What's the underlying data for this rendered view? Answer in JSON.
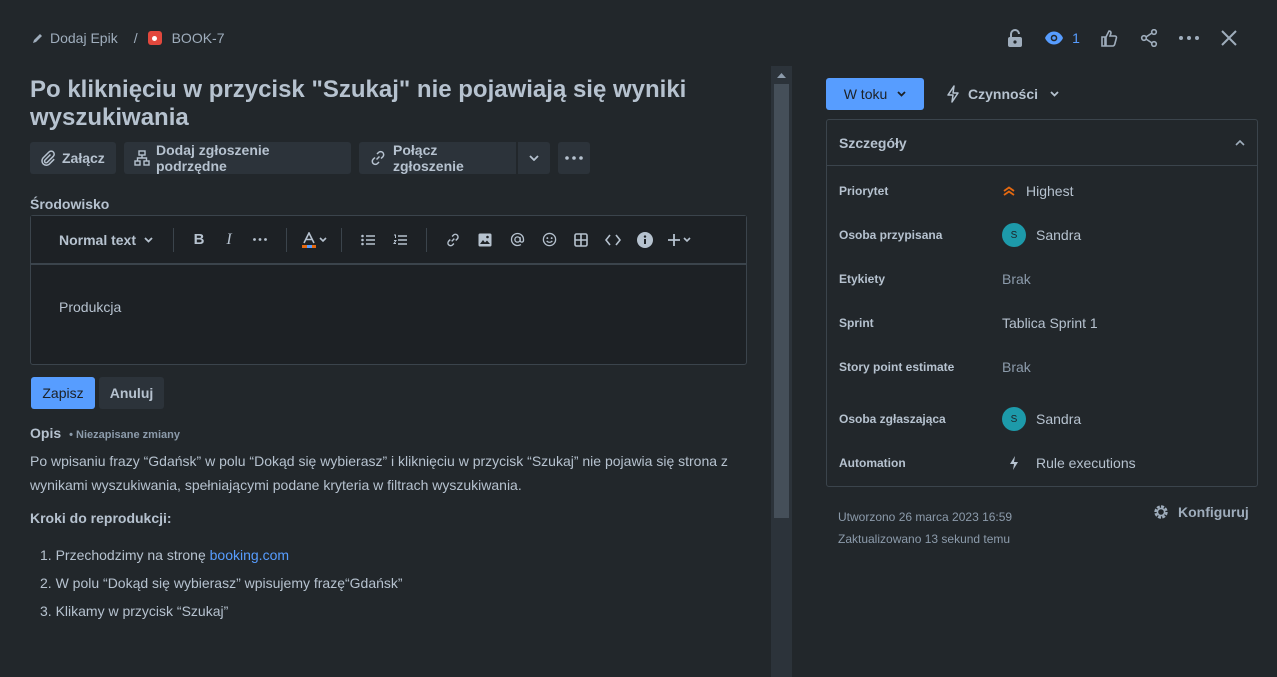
{
  "breadcrumb": {
    "add_epic": "Dodaj Epik",
    "separator": "/",
    "issue_key": "BOOK-7"
  },
  "header": {
    "watchers_count": "1"
  },
  "issue": {
    "title": "Po kliknięciu w przycisk \"Szukaj\" nie pojawiają się wyniki wyszukiwania"
  },
  "actions": {
    "attach": "Załącz",
    "add_child": "Dodaj zgłoszenie podrzędne",
    "link_issue": "Połącz zgłoszenie"
  },
  "environment": {
    "label": "Środowisko",
    "text_style": "Normal text",
    "content": "Produkcja",
    "save": "Zapisz",
    "cancel": "Anuluj"
  },
  "description": {
    "label": "Opis",
    "unsaved": "• Niezapisane zmiany",
    "text": "Po wpisaniu frazy “Gdańsk” w polu “Dokąd się wybierasz” i kliknięciu w przycisk “Szukaj” nie pojawia się strona z wynikami wyszukiwania, spełniającymi podane kryteria w filtrach wyszukiwania.",
    "steps_label": "Kroki do reprodukcji:",
    "step1_prefix": "1. Przechodzimy na stronę ",
    "step1_link": "booking.com",
    "step2": "2. W polu “Dokąd się wybierasz” wpisujemy frazę“Gdańsk”",
    "step3": "3. Klikamy w przycisk “Szukaj”"
  },
  "sidebar": {
    "status": "W toku",
    "actions": "Czynności",
    "details_title": "Szczegóły",
    "fields": [
      {
        "key": "Priorytet",
        "value": "Highest"
      },
      {
        "key": "Osoba przypisana",
        "value": "Sandra",
        "avatar": "S"
      },
      {
        "key": "Etykiety",
        "value": "Brak"
      },
      {
        "key": "Sprint",
        "value": "Tablica Sprint 1"
      },
      {
        "key": "Story point estimate",
        "value": "Brak"
      },
      {
        "key": "Osoba zgłaszająca",
        "value": "Sandra",
        "avatar": "S"
      },
      {
        "key": "Automation",
        "value": "Rule executions"
      }
    ],
    "created": "Utworzono 26 marca 2023 16:59",
    "updated": "Zaktualizowano 13 sekund temu",
    "configure": "Konfiguruj"
  },
  "colors": {
    "background": "#22272b",
    "accent": "#579dff",
    "priority_high": "#e56910",
    "avatar": "#1d9aaa"
  }
}
